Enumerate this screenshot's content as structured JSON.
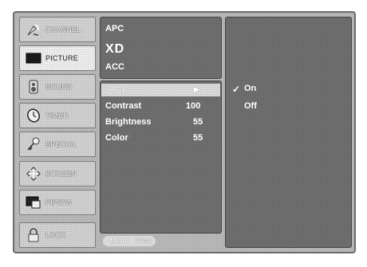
{
  "sidebar": {
    "items": [
      {
        "label": "CHANNEL",
        "icon": "satellite-dish-icon"
      },
      {
        "label": "PICTURE",
        "icon": "picture-screen-icon"
      },
      {
        "label": "SOUND",
        "icon": "speaker-icon"
      },
      {
        "label": "TIMER",
        "icon": "clock-icon"
      },
      {
        "label": "SPECIAL",
        "icon": "key-icon"
      },
      {
        "label": "SCREEN",
        "icon": "screen-arrows-icon"
      },
      {
        "label": "PIP/DW",
        "icon": "pip-windows-icon"
      },
      {
        "label": "LOCK",
        "icon": "padlock-icon"
      }
    ],
    "active_index": 1
  },
  "menu": {
    "top_items": [
      "APC",
      "XD",
      "ACC"
    ],
    "rows": [
      {
        "label": "sRGB",
        "value": "▶"
      },
      {
        "label": "Contrast",
        "value": "100"
      },
      {
        "label": "Brightness",
        "value": "55"
      },
      {
        "label": "Color",
        "value": "55"
      }
    ]
  },
  "submenu": {
    "check_mark": "✓",
    "options": [
      "On",
      "Off"
    ],
    "selected_index": 0
  },
  "footer": {
    "menu_label": "Menu",
    "prev_label": "Prev."
  }
}
